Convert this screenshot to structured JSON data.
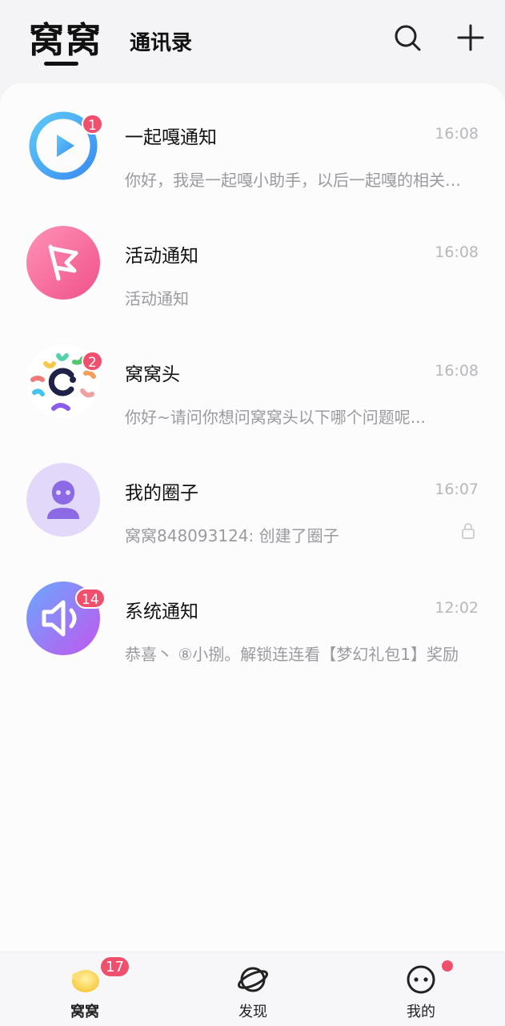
{
  "header": {
    "active_tab": "窝窝",
    "secondary_tab": "通讯录",
    "search_icon": "search-icon",
    "add_icon": "plus-icon"
  },
  "conversations": [
    {
      "name": "一起嘎通知",
      "time": "16:08",
      "preview": "你好，我是一起嘎小助手，以后一起嘎的相关通知会在这里发送给你",
      "badge": "1",
      "icon": "play-icon"
    },
    {
      "name": "活动通知",
      "time": "16:08",
      "preview": "活动通知",
      "badge": "",
      "icon": "flag-icon"
    },
    {
      "name": "窝窝头",
      "time": "16:08",
      "preview": "你好~请问你想问窝窝头以下哪个问题呢...",
      "badge": "2",
      "icon": "wowotou-logo-icon"
    },
    {
      "name": "我的圈子",
      "time": "16:07",
      "preview": "窝窝848093124: 创建了圈子",
      "badge": "",
      "icon": "person-icon"
    },
    {
      "name": "系统通知",
      "time": "12:02",
      "preview": "恭喜丶 ⑧小捌。解锁连连看【梦幻礼包1】奖励",
      "badge": "14",
      "icon": "speaker-icon"
    }
  ],
  "tabbar": {
    "items": [
      {
        "label": "窝窝",
        "badge": "17",
        "icon": "wowo-icon"
      },
      {
        "label": "发现",
        "icon": "planet-icon"
      },
      {
        "label": "我的",
        "icon": "face-icon"
      }
    ]
  },
  "colors": {
    "badge": "#f0506e",
    "background": "#f4f4f6"
  }
}
